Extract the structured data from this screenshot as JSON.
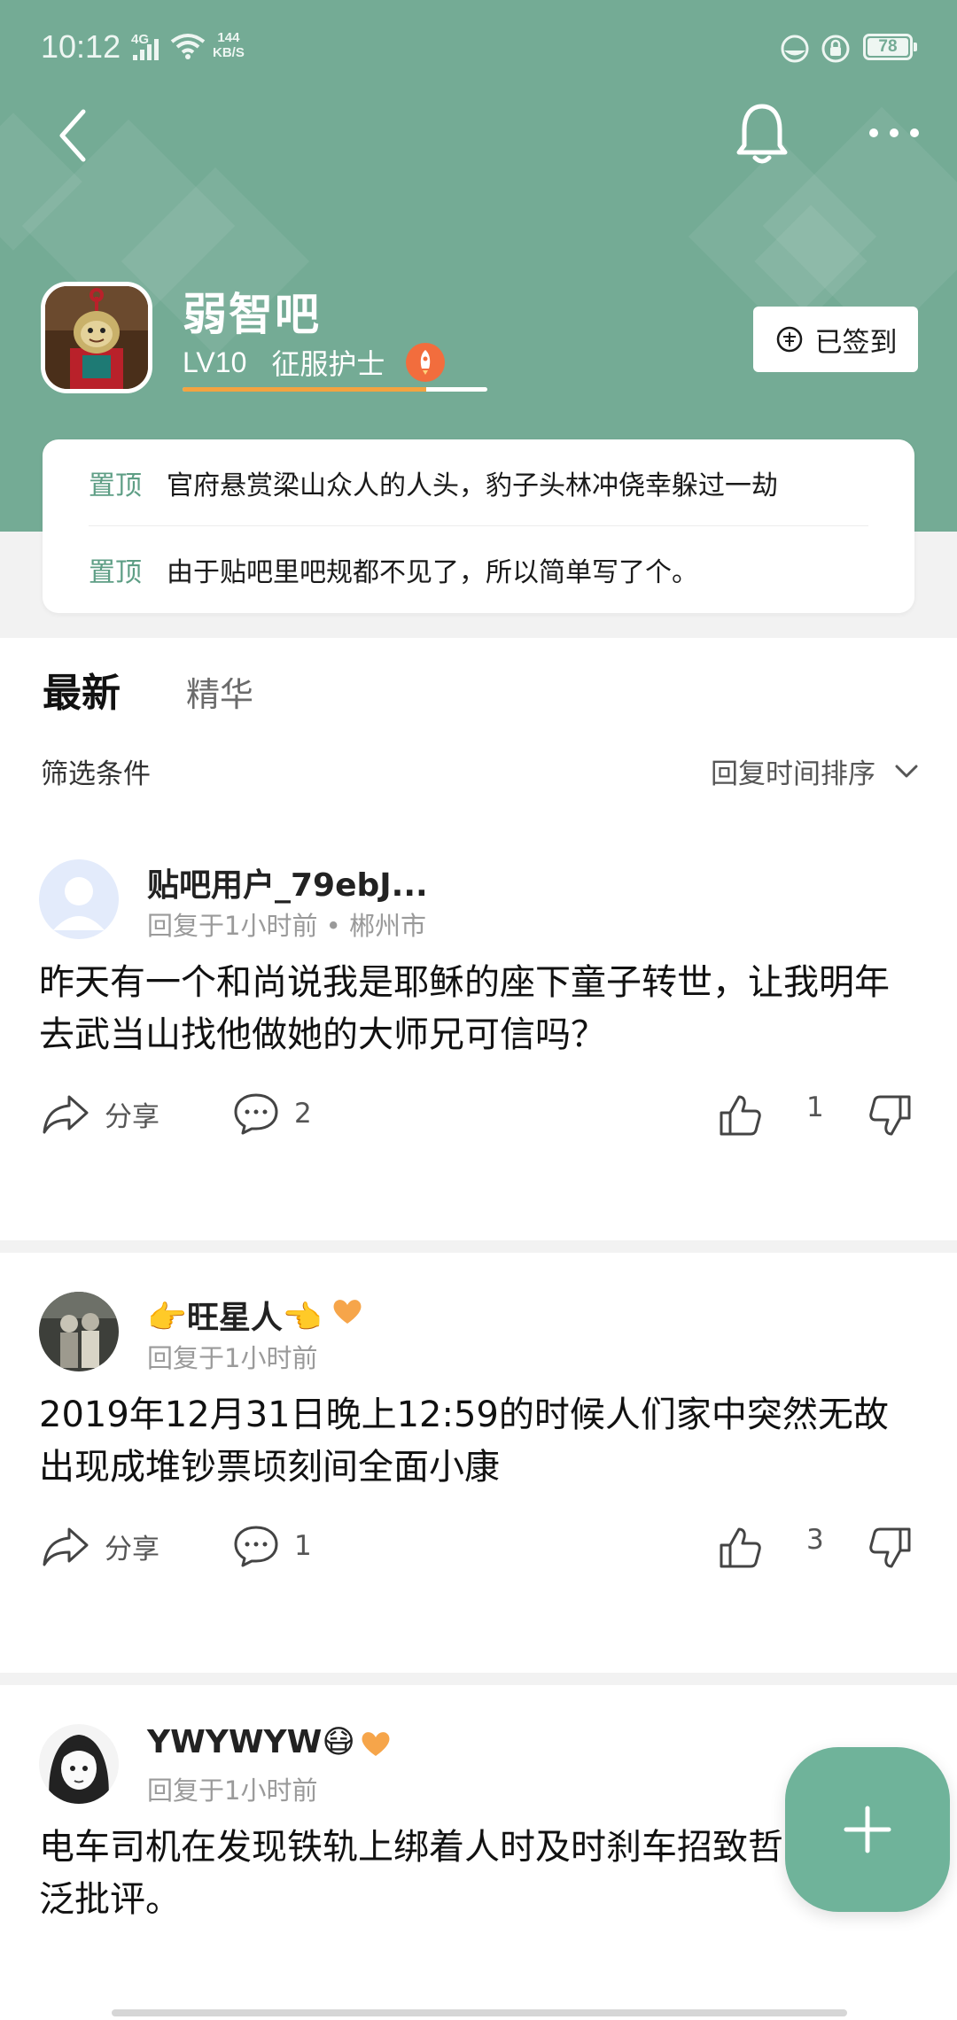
{
  "status_bar": {
    "time": "10:12",
    "network": "4G",
    "speed_value": "144",
    "speed_unit": "KB/S",
    "battery": "78"
  },
  "forum": {
    "name": "弱智吧",
    "level": "LV10",
    "title": "征服护士",
    "level_progress": 0.8,
    "sign_label": "已签到"
  },
  "pinned": [
    {
      "tag": "置顶",
      "text": "官府悬赏梁山众人的人头，豹子头林冲侥幸躲过一劫"
    },
    {
      "tag": "置顶",
      "text": "由于贴吧里吧规都不见了，所以简单写了个。"
    }
  ],
  "tabs": {
    "latest": "最新",
    "featured": "精华"
  },
  "filter": {
    "label": "筛选条件",
    "sort": "回复时间排序"
  },
  "posts": [
    {
      "user": "贴吧用户_79ebJ...",
      "meta": "回复于1小时前 • 郴州市",
      "content": "昨天有一个和尚说我是耶稣的座下童子转世，让我明年去武当山找他做她的大师兄可信吗？",
      "share": "分享",
      "comments": "2",
      "likes": "1"
    },
    {
      "user": "👉旺星人👈",
      "meta": "回复于1小时前",
      "content": "2019年12月31日晚上12:59的时候人们家中突然无故出现成堆钞票顷刻间全面小康",
      "share": "分享",
      "comments": "1",
      "likes": "3"
    },
    {
      "user": "YWYWYW😷",
      "meta": "回复于1小时前",
      "content": "电车司机在发现铁轨上绑着人时及时刹车招致哲学界广泛批评。"
    }
  ],
  "colors": {
    "header": "#74ab95",
    "accent": "#6fb39a",
    "pin_tag": "#5e9e85"
  }
}
